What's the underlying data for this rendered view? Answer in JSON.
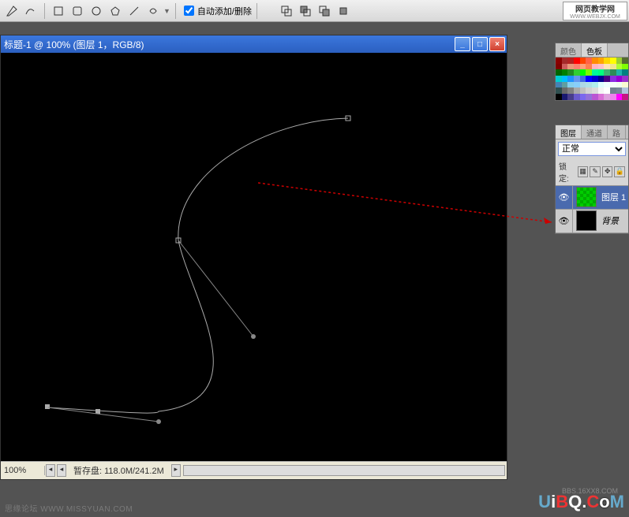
{
  "toolbar": {
    "auto_add_delete_label": "自动添加/删除",
    "auto_add_delete_checked": true
  },
  "logo": {
    "text": "网页教学网",
    "url": "WWW.WEBJX.COM"
  },
  "document": {
    "title": "标题-1 @ 100%  (图层 1，RGB/8)"
  },
  "status": {
    "zoom": "100%",
    "scratch_label": "暂存盘:",
    "scratch_value": "118.0M/241.2M"
  },
  "swatch_panel": {
    "tabs": [
      "颜色",
      "色板"
    ],
    "active_tab": 1,
    "colors": [
      [
        "#8b0000",
        "#a52a2a",
        "#b22222",
        "#ff0000",
        "#ff4500",
        "#ff6347",
        "#ff8c00",
        "#ffa500",
        "#ffd700",
        "#ffff00",
        "#9acd32",
        "#556b2f"
      ],
      [
        "#800000",
        "#cd5c5c",
        "#e9967a",
        "#fa8072",
        "#ffa07a",
        "#ff7f50",
        "#ffb6c1",
        "#ffc0cb",
        "#ffe4b5",
        "#f0e68c",
        "#adff2f",
        "#7fff00"
      ],
      [
        "#006400",
        "#008000",
        "#228b22",
        "#32cd32",
        "#00ff00",
        "#7cfc00",
        "#00fa9a",
        "#00ff7f",
        "#3cb371",
        "#2e8b57",
        "#20b2aa",
        "#008080"
      ],
      [
        "#00ced1",
        "#00bfff",
        "#1e90ff",
        "#6495ed",
        "#4169e1",
        "#0000ff",
        "#0000cd",
        "#00008b",
        "#4b0082",
        "#8a2be2",
        "#9400d3",
        "#9932cc"
      ],
      [
        "#4682b4",
        "#5f9ea0",
        "#87ceeb",
        "#87cefa",
        "#add8e6",
        "#b0e0e6",
        "#afeeee",
        "#e0ffff",
        "#f0ffff",
        "#f5fffa",
        "#f0fff0",
        "#fafad2"
      ],
      [
        "#2f4f4f",
        "#696969",
        "#808080",
        "#a9a9a9",
        "#c0c0c0",
        "#d3d3d3",
        "#dcdcdc",
        "#f5f5f5",
        "#ffffff",
        "#708090",
        "#778899",
        "#b0c4de"
      ],
      [
        "#000000",
        "#191970",
        "#483d8b",
        "#6a5acd",
        "#7b68ee",
        "#9370db",
        "#ba55d3",
        "#da70d6",
        "#dda0dd",
        "#ee82ee",
        "#ff00ff",
        "#c71585"
      ]
    ]
  },
  "layers_panel": {
    "tabs": [
      "图层",
      "通道",
      "路"
    ],
    "active_tab": 0,
    "blend_mode": "正常",
    "lock_label": "锁定:",
    "layers": [
      {
        "name": "图层 1",
        "visible": true,
        "active": true,
        "thumb": "green"
      },
      {
        "name": "背景",
        "visible": true,
        "active": false,
        "thumb": "black"
      }
    ]
  },
  "footer": {
    "left": "思缘论坛  WWW.MISSYUAN.COM",
    "right_sub": "BBS.16XX8.COM"
  }
}
